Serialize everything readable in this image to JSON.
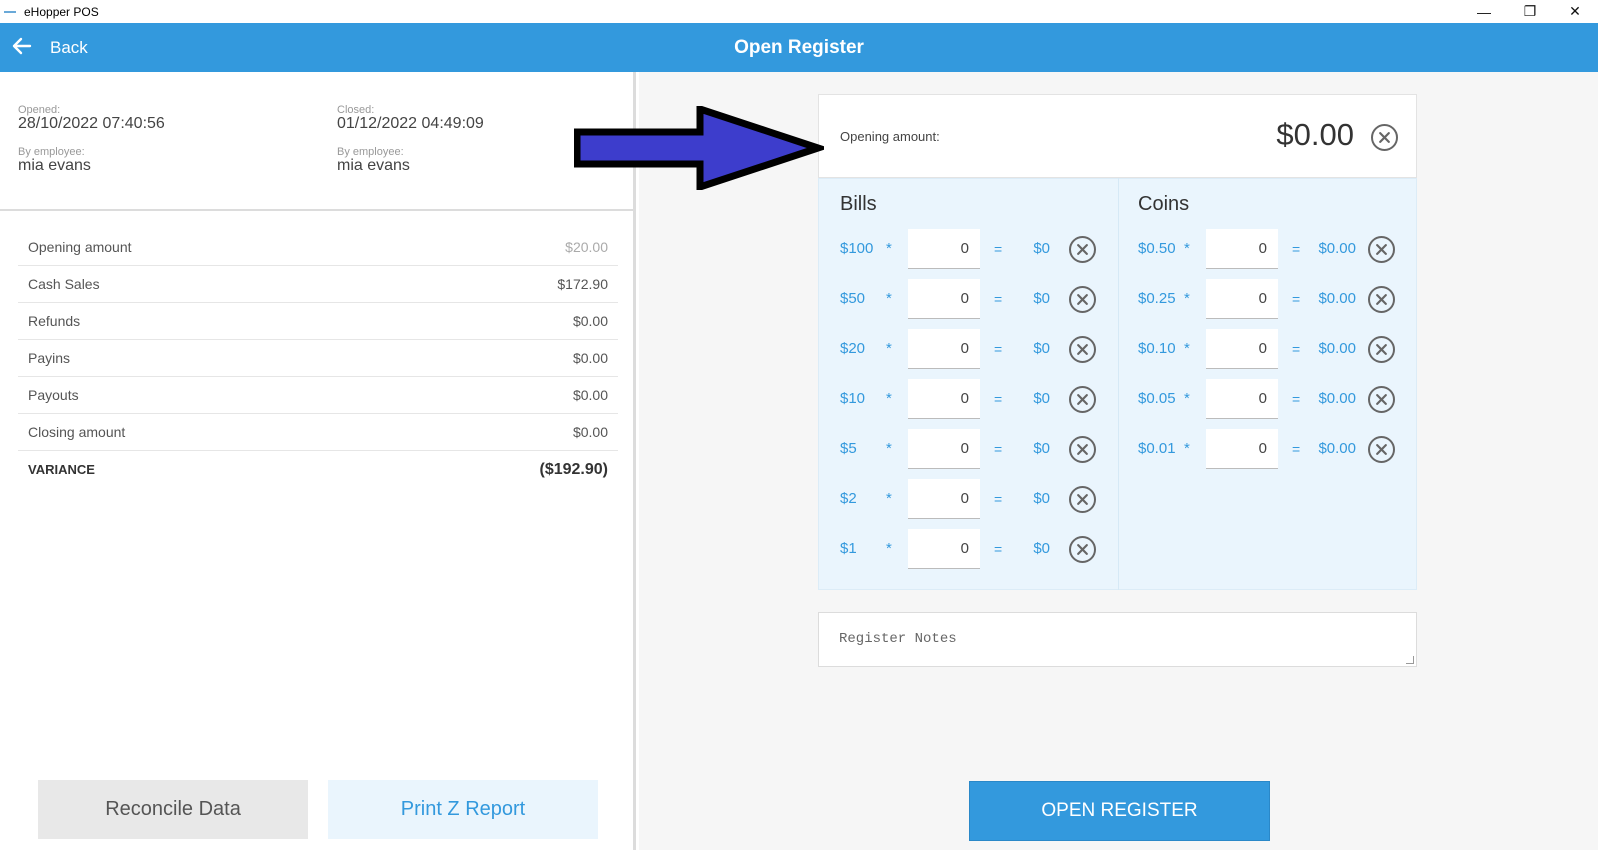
{
  "window": {
    "title": "eHopper POS",
    "controls": {
      "minimize": "—",
      "maximize": "❐",
      "close": "✕"
    }
  },
  "appbar": {
    "back_label": "Back",
    "title": "Open Register",
    "color": "#3399dd"
  },
  "left": {
    "opened_label": "Opened:",
    "opened_value": "28/10/2022 07:40:56",
    "opened_by_label": "By employee:",
    "opened_by_value": "mia evans",
    "closed_label": "Closed:",
    "closed_value": "01/12/2022 04:49:09",
    "closed_by_label": "By employee:",
    "closed_by_value": "mia evans",
    "summary": [
      {
        "label": "Opening amount",
        "value": "$20.00"
      },
      {
        "label": "Cash Sales",
        "value": "$172.90"
      },
      {
        "label": "Refunds",
        "value": "$0.00"
      },
      {
        "label": "Payins",
        "value": "$0.00"
      },
      {
        "label": "Payouts",
        "value": "$0.00"
      },
      {
        "label": "Closing amount",
        "value": "$0.00"
      },
      {
        "label": "VARIANCE",
        "value": "($192.90)"
      }
    ],
    "reconcile_label": "Reconcile Data",
    "print_label": "Print Z Report"
  },
  "right": {
    "opening_label": "Opening amount:",
    "opening_value": "$0.00",
    "bills_title": "Bills",
    "coins_title": "Coins",
    "bills": [
      {
        "denom": "$100",
        "qty": "0",
        "total": "$0"
      },
      {
        "denom": "$50",
        "qty": "0",
        "total": "$0"
      },
      {
        "denom": "$20",
        "qty": "0",
        "total": "$0"
      },
      {
        "denom": "$10",
        "qty": "0",
        "total": "$0"
      },
      {
        "denom": "$5",
        "qty": "0",
        "total": "$0"
      },
      {
        "denom": "$2",
        "qty": "0",
        "total": "$0"
      },
      {
        "denom": "$1",
        "qty": "0",
        "total": "$0"
      }
    ],
    "coins": [
      {
        "denom": "$0.50",
        "qty": "0",
        "total": "$0.00"
      },
      {
        "denom": "$0.25",
        "qty": "0",
        "total": "$0.00"
      },
      {
        "denom": "$0.10",
        "qty": "0",
        "total": "$0.00"
      },
      {
        "denom": "$0.05",
        "qty": "0",
        "total": "$0.00"
      },
      {
        "denom": "$0.01",
        "qty": "0",
        "total": "$0.00"
      }
    ],
    "symbols": {
      "multiply": "*",
      "equals": "="
    },
    "notes_placeholder": "Register Notes",
    "open_button_label": "OPEN REGISTER"
  },
  "annotation": {
    "icon": "arrow-right-icon",
    "fill": "#3d3dcc",
    "stroke": "#000000"
  }
}
